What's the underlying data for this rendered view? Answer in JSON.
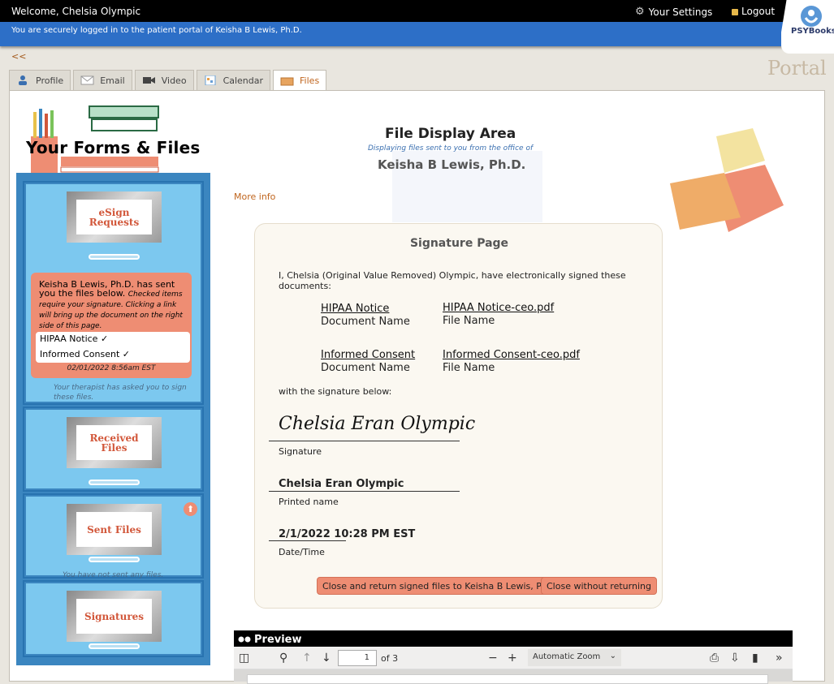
{
  "header": {
    "welcome": "Welcome, Chelsia Olympic",
    "settings_label": "Your Settings",
    "logout_label": "Logout",
    "secure_message": "You are securely logged in to the patient portal of Keisha B Lewis, Ph.D.",
    "logo_text": "PSYBooks",
    "back_label": "<<",
    "portal_label": "Portal"
  },
  "tabs": [
    {
      "label": "Profile",
      "icon": "person-icon"
    },
    {
      "label": "Email",
      "icon": "envelope-icon"
    },
    {
      "label": "Video",
      "icon": "camera-icon"
    },
    {
      "label": "Calendar",
      "icon": "calendar-icon"
    },
    {
      "label": "Files",
      "icon": "folder-icon",
      "active": true
    }
  ],
  "sidebar": {
    "title": "Your Forms & Files",
    "esign": {
      "label_line1": "eSign",
      "label_line2": "Requests",
      "note_head": "Keisha B Lewis, Ph.D. has sent you the files below.",
      "note_italic": "Checked items require your signature. Clicking a link will bring up the document on the right side of this page.",
      "files": [
        "HIPAA Notice ✓",
        "Informed Consent ✓"
      ],
      "date": "02/01/2022 8:56am EST",
      "footer": "Your therapist has asked you to sign these files."
    },
    "received": {
      "label_line1": "Received",
      "label_line2": "Files"
    },
    "sent": {
      "label": "Sent Files",
      "footer": "You have not sent any files."
    },
    "signatures": {
      "label": "Signatures"
    }
  },
  "display": {
    "title": "File Display Area",
    "subtitle": "Displaying files sent to you from the office of",
    "doctor": "Keisha B Lewis, Ph.D.",
    "more_info": "More info"
  },
  "signature_page": {
    "title": "Signature Page",
    "statement": "I, Chelsia (Original Value Removed) Olympic, have electronically signed these documents:",
    "documents": [
      {
        "doc_name": "HIPAA Notice",
        "file_name": "HIPAA Notice-ceo.pdf"
      },
      {
        "doc_name": "Informed Consent",
        "file_name": "Informed Consent-ceo.pdf"
      }
    ],
    "doc_label": "Document Name",
    "file_label": "File Name",
    "with_signature": "with the signature below:",
    "signature": "Chelsia Eran Olympic",
    "signature_label": "Signature",
    "printed_name": "Chelsia Eran Olympic",
    "printed_label": "Printed name",
    "datetime": "2/1/2022 10:28 PM EST",
    "datetime_label": "Date/Time",
    "btn_close_return": "Close and return signed files to Keisha B Lewis, Ph.D.",
    "btn_close_no_return": "Close without returning"
  },
  "preview": {
    "title": "Preview",
    "page_value": "1",
    "page_count": "of 3",
    "zoom": "Automatic Zoom"
  }
}
